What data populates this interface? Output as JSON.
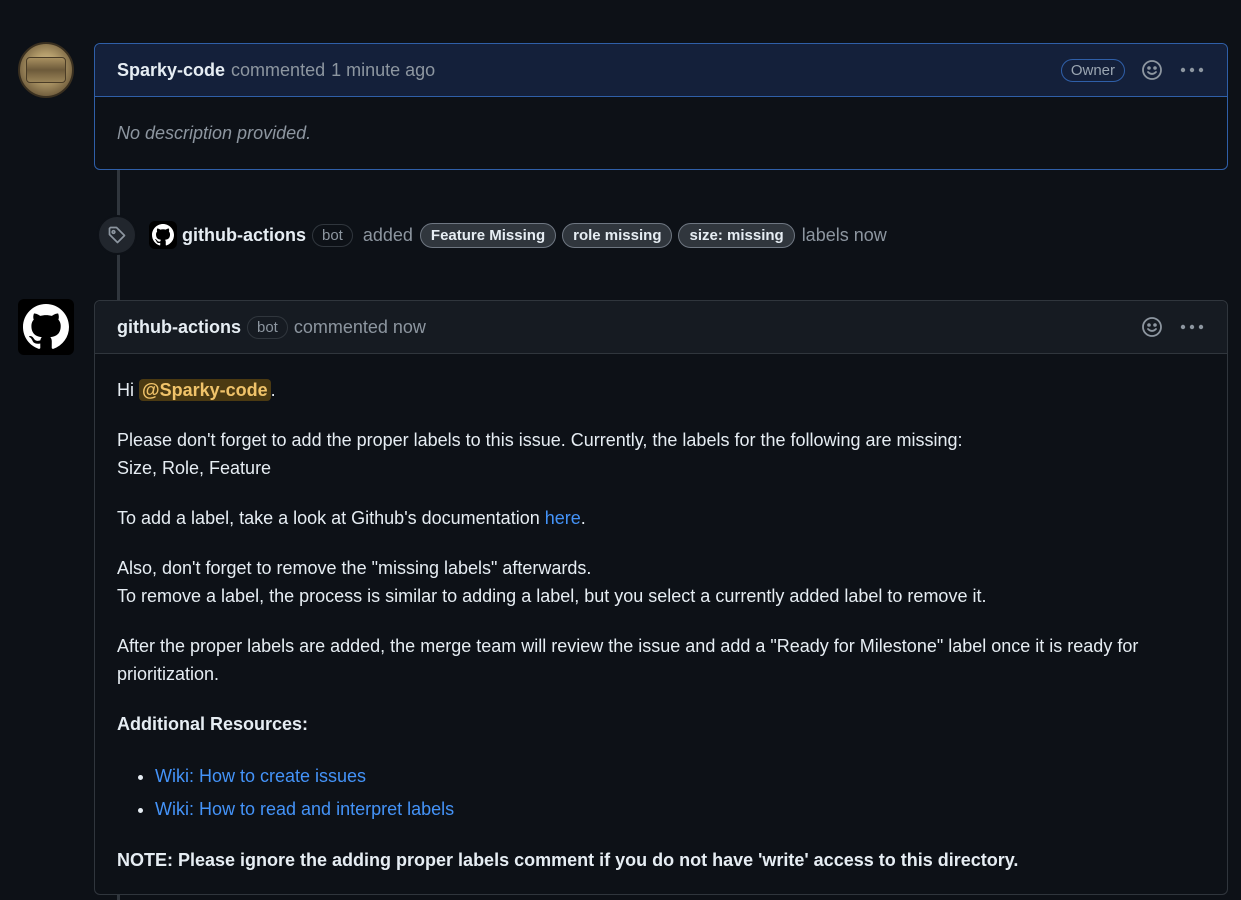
{
  "owner_comment": {
    "author": "Sparky-code",
    "action": "commented",
    "time": "1 minute ago",
    "badge": "Owner",
    "body": "No description provided."
  },
  "label_event": {
    "actor": "github-actions",
    "actor_badge": "bot",
    "verb": "added",
    "labels": [
      "Feature Missing",
      "role missing",
      "size: missing"
    ],
    "suffix": "labels now"
  },
  "bot_comment": {
    "author": "github-actions",
    "badge": "bot",
    "action": "commented now",
    "greeting": "Hi",
    "mention": "@Sparky-code",
    "greeting_end": ".",
    "para1_line1": "Please don't forget to add the proper labels to this issue. Currently, the labels for the following are missing:",
    "para1_line2": "Size, Role, Feature",
    "para2_text": "To add a label, take a look at Github's documentation ",
    "para2_link": "here",
    "para2_end": ".",
    "para3_line1": "Also, don't forget to remove the \"missing labels\" afterwards.",
    "para3_line2": "To remove a label, the process is similar to adding a label, but you select a currently added label to remove it.",
    "para4": "After the proper labels are added, the merge team will review the issue and add a \"Ready for Milestone\" label once it is ready for prioritization.",
    "resources_heading": "Additional Resources:",
    "resources": [
      "Wiki: How to create issues",
      "Wiki: How to read and interpret labels"
    ],
    "note": "NOTE: Please ignore the adding proper labels comment if you do not have 'write' access to this directory."
  },
  "icons": {
    "reaction": "smiley-icon",
    "more": "kebab-horizontal-icon",
    "tag": "tag-icon",
    "github": "github-mark-icon"
  },
  "colors": {
    "background": "#0d1117",
    "link": "#4493f8",
    "mention_bg": "#4b3a12",
    "mention_fg": "#f0c36a",
    "owner_border": "#2f5fa8"
  }
}
